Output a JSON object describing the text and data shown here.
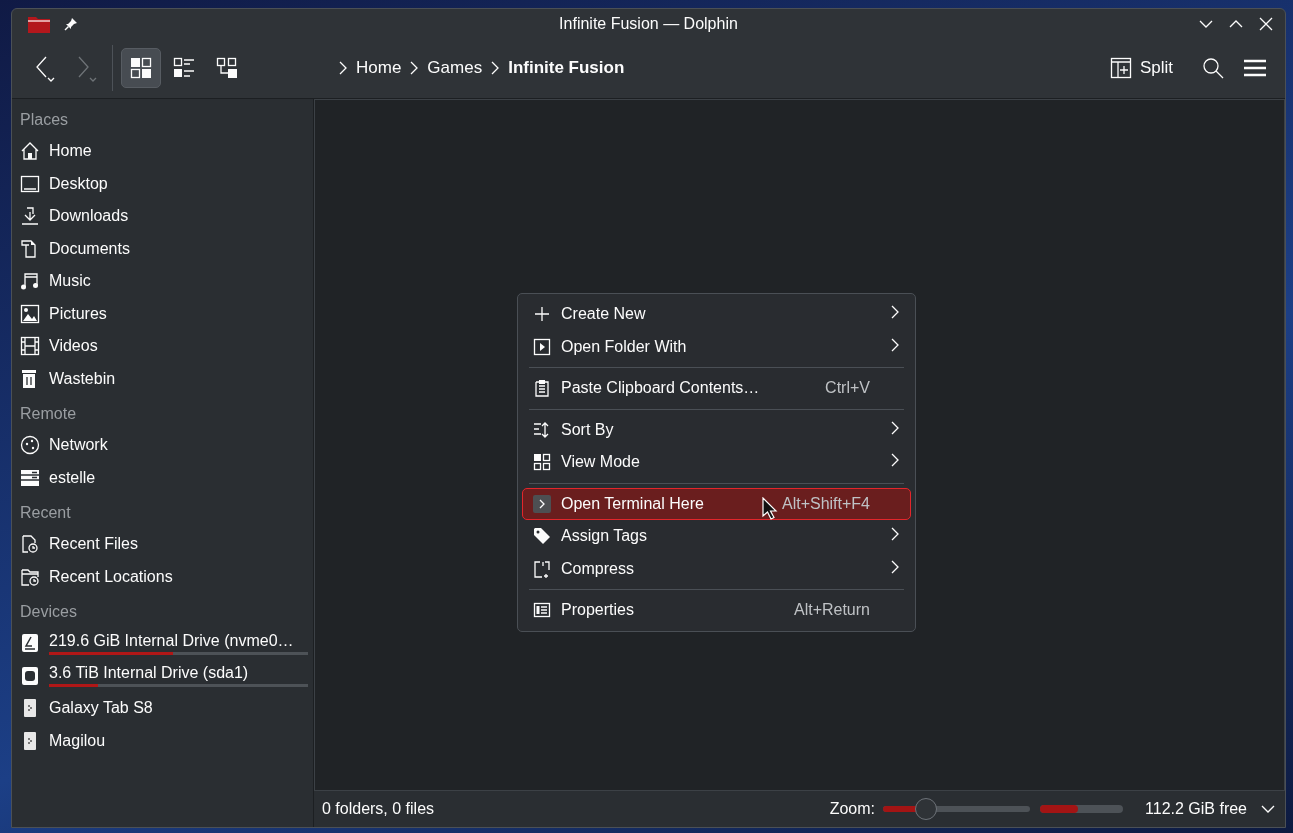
{
  "window": {
    "title": "Infinite Fusion — Dolphin"
  },
  "toolbar": {
    "view_modes": [
      {
        "selected": true
      },
      {
        "selected": false
      },
      {
        "selected": false
      }
    ],
    "breadcrumb": [
      {
        "label": "Home",
        "current": false
      },
      {
        "label": "Games",
        "current": false
      },
      {
        "label": "Infinite Fusion",
        "current": true
      }
    ],
    "split_label": "Split"
  },
  "sidebar": {
    "sections": [
      {
        "heading": "Places",
        "items": [
          {
            "label": "Home"
          },
          {
            "label": "Desktop"
          },
          {
            "label": "Downloads"
          },
          {
            "label": "Documents"
          },
          {
            "label": "Music"
          },
          {
            "label": "Pictures"
          },
          {
            "label": "Videos"
          },
          {
            "label": "Wastebin"
          }
        ]
      },
      {
        "heading": "Remote",
        "items": [
          {
            "label": "Network"
          },
          {
            "label": "estelle"
          }
        ]
      },
      {
        "heading": "Recent",
        "items": [
          {
            "label": "Recent Files"
          },
          {
            "label": "Recent Locations"
          }
        ]
      },
      {
        "heading": "Devices",
        "items": [
          {
            "label": "219.6 GiB Internal Drive (nvme0…",
            "level": 0.48
          },
          {
            "label": "3.6 TiB Internal Drive (sda1)",
            "level": 0.19
          },
          {
            "label": "Galaxy Tab S8"
          },
          {
            "label": "Magilou"
          }
        ]
      }
    ]
  },
  "context_menu": {
    "groups": [
      [
        {
          "label": "Create New",
          "submenu": true,
          "selected": false
        },
        {
          "label": "Open Folder With",
          "submenu": true,
          "selected": false
        }
      ],
      [
        {
          "label": "Paste Clipboard Contents…",
          "shortcut": "Ctrl+V",
          "submenu": false,
          "selected": false
        }
      ],
      [
        {
          "label": "Sort By",
          "submenu": true,
          "selected": false
        },
        {
          "label": "View Mode",
          "submenu": true,
          "selected": false
        }
      ],
      [
        {
          "label": "Open Terminal Here",
          "shortcut": "Alt+Shift+F4",
          "submenu": false,
          "selected": true
        },
        {
          "label": "Assign Tags",
          "submenu": true,
          "selected": false
        },
        {
          "label": "Compress",
          "submenu": true,
          "selected": false
        }
      ],
      [
        {
          "label": "Properties",
          "shortcut": "Alt+Return",
          "submenu": false,
          "selected": false
        }
      ]
    ]
  },
  "status_bar": {
    "summary": "0 folders, 0 files",
    "zoom_label": "Zoom:",
    "zoom": {
      "level": 0.29
    },
    "space": {
      "level": 0.46
    },
    "free_space": "112.2 GiB free"
  }
}
